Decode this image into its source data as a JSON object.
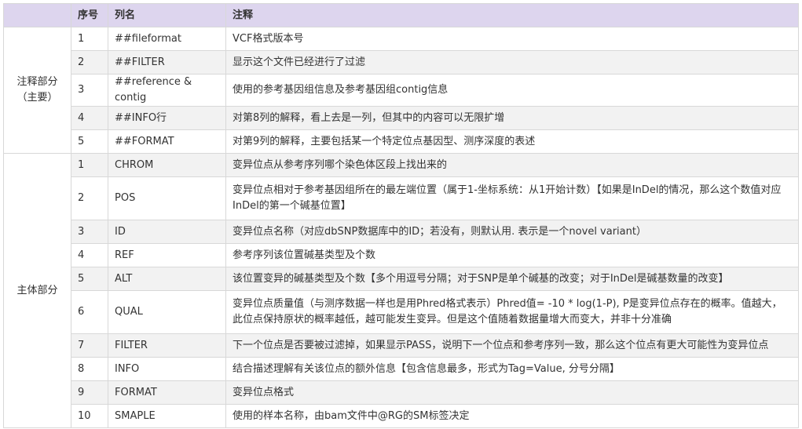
{
  "headers": {
    "group": "",
    "num": "序号",
    "name": "列名",
    "note": "注释"
  },
  "groups": [
    {
      "label_line1": "注释部分",
      "label_line2": "（主要）",
      "rows": [
        {
          "num": "1",
          "name": "##fileformat",
          "note": "VCF格式版本号"
        },
        {
          "num": "2",
          "name": "##FILTER",
          "note": "显示这个文件已经进行了过滤"
        },
        {
          "num": "3",
          "name": "##reference & contig",
          "note": "使用的参考基因组信息及参考基因组contig信息"
        },
        {
          "num": "4",
          "name": "##INFO行",
          "note": "对第8列的解释，看上去是一列，但其中的内容可以无限扩增"
        },
        {
          "num": "5",
          "name": "##FORMAT",
          "note": "对第9列的解释，主要包括某一个特定位点基因型、测序深度的表述"
        }
      ]
    },
    {
      "label_line1": "主体部分",
      "label_line2": "",
      "rows": [
        {
          "num": "1",
          "name": "CHROM",
          "note": "变异位点从参考序列哪个染色体区段上找出来的"
        },
        {
          "num": "2",
          "name": "POS",
          "note": "变异位点相对于参考基因组所在的最左端位置（属于1-坐标系统：从1开始计数）【如果是InDel的情况，那么这个数值对应InDel的第一个碱基位置】"
        },
        {
          "num": "3",
          "name": "ID",
          "note": "变异位点名称（对应dbSNP数据库中的ID；若没有，则默认用. 表示是一个novel variant）"
        },
        {
          "num": "4",
          "name": "REF",
          "note": "参考序列该位置碱基类型及个数"
        },
        {
          "num": "5",
          "name": "ALT",
          "note": "该位置变异的碱基类型及个数【多个用逗号分隔；对于SNP是单个碱基的改变；对于InDel是碱基数量的改变】"
        },
        {
          "num": "6",
          "name": "QUAL",
          "note": "变异位点质量值（与测序数据一样也是用Phred格式表示）Phred值= -10 * log(1-P), P是变异位点存在的概率。值越大，此位点保持原状的概率越低，越可能发生变异。但是这个值随着数据量增大而变大，并非十分准确"
        },
        {
          "num": "7",
          "name": "FILTER",
          "note": "下一个位点是否要被过滤掉，如果显示PASS，说明下一个位点和参考序列一致，那么这个位点有更大可能性为变异位点"
        },
        {
          "num": "8",
          "name": "INFO",
          "note": "结合描述理解有关该位点的额外信息【包含信息最多，形式为Tag=Value, 分号分隔】"
        },
        {
          "num": "9",
          "name": "FORMAT",
          "note": "变异位点格式"
        },
        {
          "num": "10",
          "name": "SMAPLE",
          "note": "使用的样本名称，由bam文件中@RG的SM标签决定"
        }
      ]
    }
  ]
}
